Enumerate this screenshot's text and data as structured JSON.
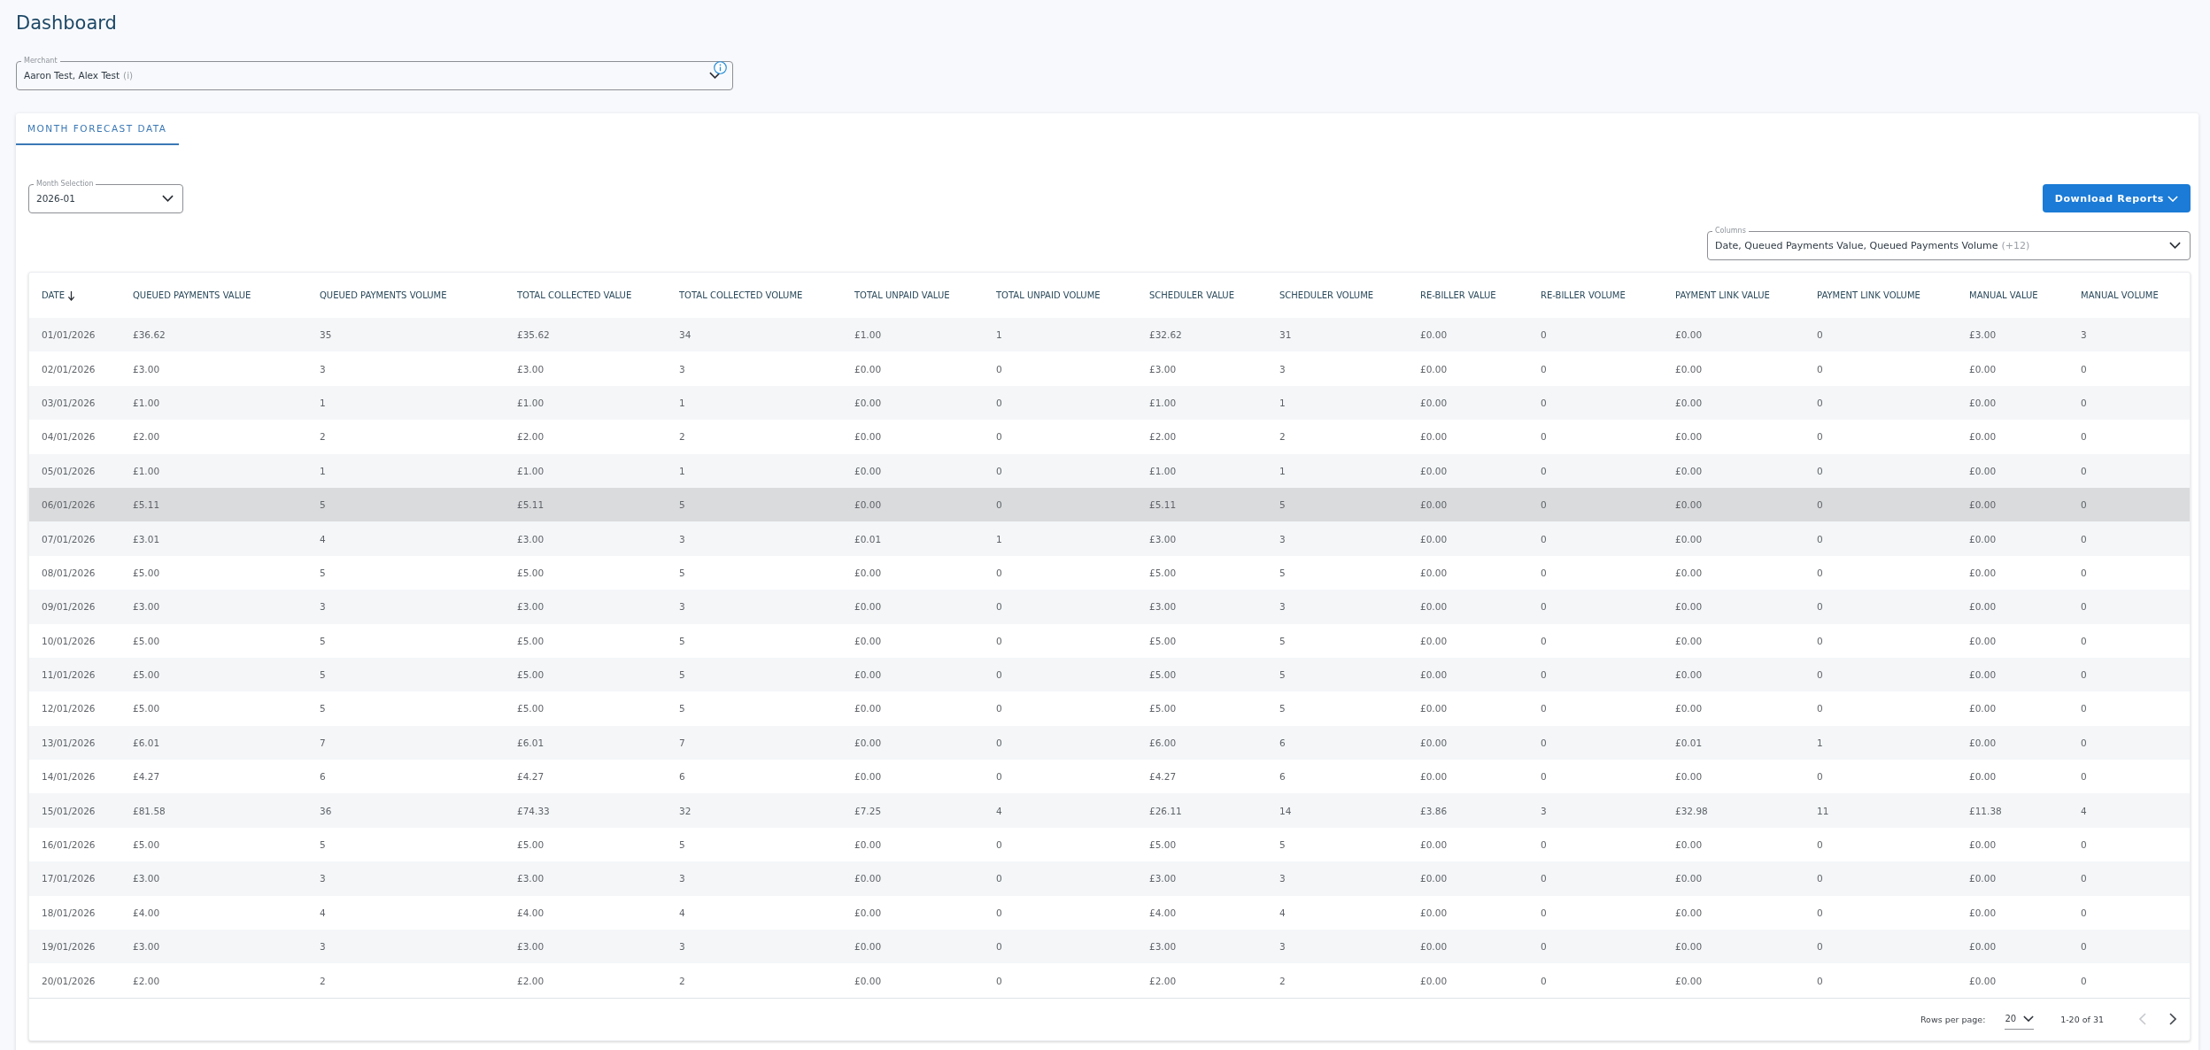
{
  "page": {
    "title": "Dashboard"
  },
  "merchant_select": {
    "label": "Merchant",
    "value": "Aaron Test, Alex Test",
    "suffix": "(i)"
  },
  "tabs": [
    {
      "label": "MONTH FORECAST DATA",
      "selected": true
    }
  ],
  "month_select": {
    "label": "Month Selection",
    "value": "2026-01"
  },
  "download_button": {
    "label": "Download Reports"
  },
  "columns_select": {
    "label": "Columns",
    "value": "Date, Queued Payments Value, Queued Payments Volume",
    "suffix": "(+12)"
  },
  "table": {
    "columns": [
      {
        "label": "DATE",
        "sorted": true
      },
      {
        "label": "QUEUED PAYMENTS VALUE",
        "sorted": false
      },
      {
        "label": "QUEUED PAYMENTS VOLUME",
        "sorted": false
      },
      {
        "label": "TOTAL COLLECTED VALUE",
        "sorted": false
      },
      {
        "label": "TOTAL COLLECTED VOLUME",
        "sorted": false
      },
      {
        "label": "TOTAL UNPAID VALUE",
        "sorted": false
      },
      {
        "label": "TOTAL UNPAID VOLUME",
        "sorted": false
      },
      {
        "label": "SCHEDULER VALUE",
        "sorted": false
      },
      {
        "label": "SCHEDULER VOLUME",
        "sorted": false
      },
      {
        "label": "RE-BILLER VALUE",
        "sorted": false
      },
      {
        "label": "RE-BILLER VOLUME",
        "sorted": false
      },
      {
        "label": "PAYMENT LINK VALUE",
        "sorted": false
      },
      {
        "label": "PAYMENT LINK VOLUME",
        "sorted": false
      },
      {
        "label": "MANUAL VALUE",
        "sorted": false
      },
      {
        "label": "MANUAL VOLUME",
        "sorted": false
      }
    ],
    "rows": [
      {
        "highlighted": false,
        "cells": [
          "01/01/2026",
          "£36.62",
          "35",
          "£35.62",
          "34",
          "£1.00",
          "1",
          "£32.62",
          "31",
          "£0.00",
          "0",
          "£0.00",
          "0",
          "£3.00",
          "3"
        ]
      },
      {
        "highlighted": false,
        "cells": [
          "02/01/2026",
          "£3.00",
          "3",
          "£3.00",
          "3",
          "£0.00",
          "0",
          "£3.00",
          "3",
          "£0.00",
          "0",
          "£0.00",
          "0",
          "£0.00",
          "0"
        ]
      },
      {
        "highlighted": false,
        "cells": [
          "03/01/2026",
          "£1.00",
          "1",
          "£1.00",
          "1",
          "£0.00",
          "0",
          "£1.00",
          "1",
          "£0.00",
          "0",
          "£0.00",
          "0",
          "£0.00",
          "0"
        ]
      },
      {
        "highlighted": false,
        "cells": [
          "04/01/2026",
          "£2.00",
          "2",
          "£2.00",
          "2",
          "£0.00",
          "0",
          "£2.00",
          "2",
          "£0.00",
          "0",
          "£0.00",
          "0",
          "£0.00",
          "0"
        ]
      },
      {
        "highlighted": false,
        "cells": [
          "05/01/2026",
          "£1.00",
          "1",
          "£1.00",
          "1",
          "£0.00",
          "0",
          "£1.00",
          "1",
          "£0.00",
          "0",
          "£0.00",
          "0",
          "£0.00",
          "0"
        ]
      },
      {
        "highlighted": true,
        "cells": [
          "06/01/2026",
          "£5.11",
          "5",
          "£5.11",
          "5",
          "£0.00",
          "0",
          "£5.11",
          "5",
          "£0.00",
          "0",
          "£0.00",
          "0",
          "£0.00",
          "0"
        ]
      },
      {
        "highlighted": false,
        "cells": [
          "07/01/2026",
          "£3.01",
          "4",
          "£3.00",
          "3",
          "£0.01",
          "1",
          "£3.00",
          "3",
          "£0.00",
          "0",
          "£0.00",
          "0",
          "£0.00",
          "0"
        ]
      },
      {
        "highlighted": false,
        "cells": [
          "08/01/2026",
          "£5.00",
          "5",
          "£5.00",
          "5",
          "£0.00",
          "0",
          "£5.00",
          "5",
          "£0.00",
          "0",
          "£0.00",
          "0",
          "£0.00",
          "0"
        ]
      },
      {
        "highlighted": false,
        "cells": [
          "09/01/2026",
          "£3.00",
          "3",
          "£3.00",
          "3",
          "£0.00",
          "0",
          "£3.00",
          "3",
          "£0.00",
          "0",
          "£0.00",
          "0",
          "£0.00",
          "0"
        ]
      },
      {
        "highlighted": false,
        "cells": [
          "10/01/2026",
          "£5.00",
          "5",
          "£5.00",
          "5",
          "£0.00",
          "0",
          "£5.00",
          "5",
          "£0.00",
          "0",
          "£0.00",
          "0",
          "£0.00",
          "0"
        ]
      },
      {
        "highlighted": false,
        "cells": [
          "11/01/2026",
          "£5.00",
          "5",
          "£5.00",
          "5",
          "£0.00",
          "0",
          "£5.00",
          "5",
          "£0.00",
          "0",
          "£0.00",
          "0",
          "£0.00",
          "0"
        ]
      },
      {
        "highlighted": false,
        "cells": [
          "12/01/2026",
          "£5.00",
          "5",
          "£5.00",
          "5",
          "£0.00",
          "0",
          "£5.00",
          "5",
          "£0.00",
          "0",
          "£0.00",
          "0",
          "£0.00",
          "0"
        ]
      },
      {
        "highlighted": false,
        "cells": [
          "13/01/2026",
          "£6.01",
          "7",
          "£6.01",
          "7",
          "£0.00",
          "0",
          "£6.00",
          "6",
          "£0.00",
          "0",
          "£0.01",
          "1",
          "£0.00",
          "0"
        ]
      },
      {
        "highlighted": false,
        "cells": [
          "14/01/2026",
          "£4.27",
          "6",
          "£4.27",
          "6",
          "£0.00",
          "0",
          "£4.27",
          "6",
          "£0.00",
          "0",
          "£0.00",
          "0",
          "£0.00",
          "0"
        ]
      },
      {
        "highlighted": false,
        "cells": [
          "15/01/2026",
          "£81.58",
          "36",
          "£74.33",
          "32",
          "£7.25",
          "4",
          "£26.11",
          "14",
          "£3.86",
          "3",
          "£32.98",
          "11",
          "£11.38",
          "4"
        ]
      },
      {
        "highlighted": false,
        "cells": [
          "16/01/2026",
          "£5.00",
          "5",
          "£5.00",
          "5",
          "£0.00",
          "0",
          "£5.00",
          "5",
          "£0.00",
          "0",
          "£0.00",
          "0",
          "£0.00",
          "0"
        ]
      },
      {
        "highlighted": false,
        "cells": [
          "17/01/2026",
          "£3.00",
          "3",
          "£3.00",
          "3",
          "£0.00",
          "0",
          "£3.00",
          "3",
          "£0.00",
          "0",
          "£0.00",
          "0",
          "£0.00",
          "0"
        ]
      },
      {
        "highlighted": false,
        "cells": [
          "18/01/2026",
          "£4.00",
          "4",
          "£4.00",
          "4",
          "£0.00",
          "0",
          "£4.00",
          "4",
          "£0.00",
          "0",
          "£0.00",
          "0",
          "£0.00",
          "0"
        ]
      },
      {
        "highlighted": false,
        "cells": [
          "19/01/2026",
          "£3.00",
          "3",
          "£3.00",
          "3",
          "£0.00",
          "0",
          "£3.00",
          "3",
          "£0.00",
          "0",
          "£0.00",
          "0",
          "£0.00",
          "0"
        ]
      },
      {
        "highlighted": false,
        "cells": [
          "20/01/2026",
          "£2.00",
          "2",
          "£2.00",
          "2",
          "£0.00",
          "0",
          "£2.00",
          "2",
          "£0.00",
          "0",
          "£0.00",
          "0",
          "£0.00",
          "0"
        ]
      }
    ]
  },
  "pagination": {
    "rows_per_page_label": "Rows per page:",
    "rows_per_page": "20",
    "range": "1-20 of 31",
    "previous": {
      "disabled": true
    },
    "next": {
      "disabled": false
    }
  }
}
